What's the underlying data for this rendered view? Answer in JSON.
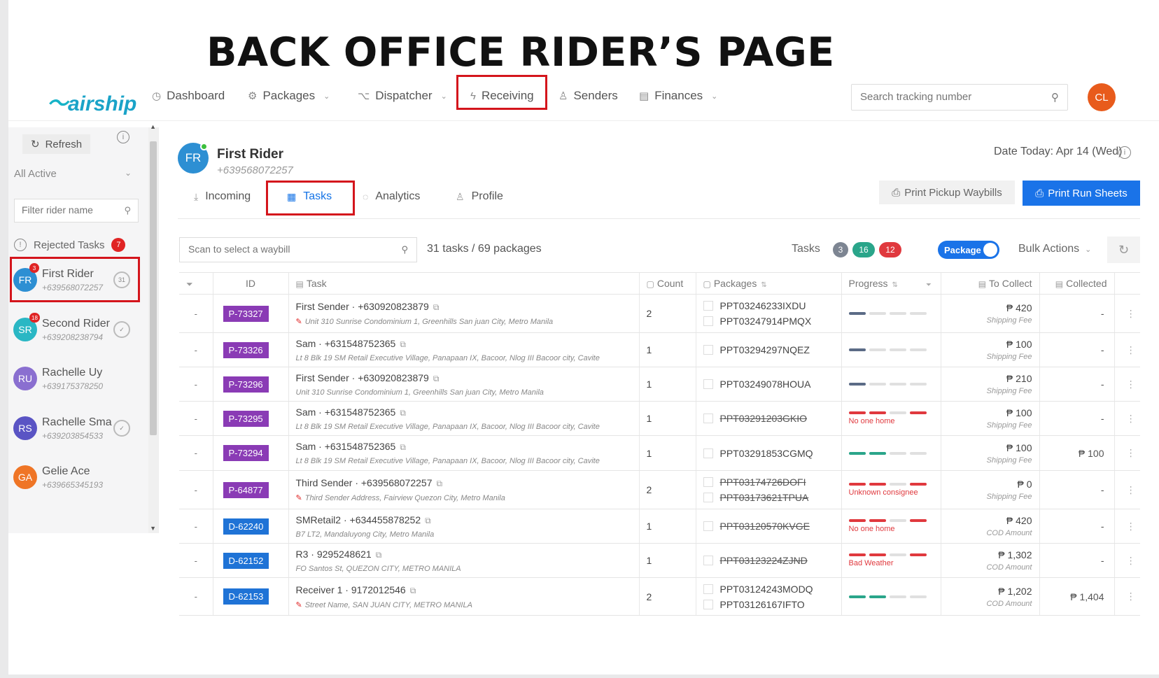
{
  "banner": "BACK OFFICE RIDER’S PAGE",
  "nav": {
    "logo": "airship",
    "items": [
      {
        "label": "Dashboard",
        "icon": "dashboard-icon"
      },
      {
        "label": "Packages",
        "icon": "box-icon"
      },
      {
        "label": "Dispatcher",
        "icon": "route-icon"
      },
      {
        "label": "Receiving",
        "icon": "bolt-icon"
      },
      {
        "label": "Senders",
        "icon": "user-icon"
      },
      {
        "label": "Finances",
        "icon": "ledger-icon"
      }
    ],
    "search_placeholder": "Search tracking number",
    "user_initials": "CL"
  },
  "sidebar": {
    "refresh": "Refresh",
    "filter_select": "All Active",
    "filter_placeholder": "Filter rider name",
    "rejected_label": "Rejected Tasks",
    "rejected_count": "7",
    "riders": [
      {
        "initials": "FR",
        "name": "First Rider",
        "phone": "+639568072257",
        "badge": "3",
        "count": "31",
        "color": "#2d8fd3"
      },
      {
        "initials": "SR",
        "name": "Second Rider",
        "phone": "+639208238794",
        "badge": "18",
        "count": "✓",
        "color": "#2ab7c4"
      },
      {
        "initials": "RU",
        "name": "Rachelle Uy",
        "phone": "+639175378250",
        "badge": "",
        "count": "",
        "color": "#8a6fd0"
      },
      {
        "initials": "RS",
        "name": "Rachelle Smal",
        "phone": "+639203854533",
        "badge": "",
        "count": "✓",
        "color": "#5a54c4"
      },
      {
        "initials": "GA",
        "name": "Gelie Ace",
        "phone": "+639665345193",
        "badge": "",
        "count": "",
        "color": "#ef7526"
      }
    ]
  },
  "rider": {
    "initials": "FR",
    "name": "First Rider",
    "phone": "+639568072257",
    "date_today": "Date Today: Apr 14 (Wed)",
    "tabs": [
      "Incoming",
      "Tasks",
      "Analytics",
      "Profile"
    ],
    "print_pickup": "Print Pickup Waybills",
    "print_run": "Print Run Sheets"
  },
  "toolbar": {
    "scan_placeholder": "Scan to select a waybill",
    "counts": "31 tasks / 69 packages",
    "tasks_label": "Tasks",
    "pill_grey": "3",
    "pill_green": "16",
    "pill_red": "12",
    "toggle_label": "Package",
    "bulk_actions": "Bulk Actions"
  },
  "table": {
    "headers": [
      "ID",
      "Task",
      "Count",
      "Packages",
      "Progress",
      "To Collect",
      "Collected"
    ],
    "rows": [
      {
        "dash": "-",
        "id": "P-73327",
        "kind": "p",
        "sender": "First Sender · +630920823879",
        "addr": "Unit 310 Sunrise Condominium 1, Greenhills San juan City, Metro Manila",
        "edit": true,
        "count": "2",
        "pkgs": [
          {
            "id": "PPT03246233IXDU",
            "strike": false
          },
          {
            "id": "PPT03247914PMQX",
            "strike": false
          }
        ],
        "prog": [
          "g",
          "l",
          "l",
          "l"
        ],
        "note": "",
        "amount": "₱ 420",
        "fee": "Shipping Fee",
        "collected": "-"
      },
      {
        "dash": "-",
        "id": "P-73326",
        "kind": "p",
        "sender": "Sam · +631548752365",
        "addr": "Lt 8 Blk 19 SM Retail Executive Village, Panapaan IX, Bacoor, Nlog III Bacoor city, Cavite",
        "edit": false,
        "count": "1",
        "pkgs": [
          {
            "id": "PPT03294297NQEZ",
            "strike": false
          }
        ],
        "prog": [
          "g",
          "l",
          "l",
          "l"
        ],
        "note": "",
        "amount": "₱ 100",
        "fee": "Shipping Fee",
        "collected": "-"
      },
      {
        "dash": "-",
        "id": "P-73296",
        "kind": "p",
        "sender": "First Sender · +630920823879",
        "addr": "Unit 310 Sunrise Condominium 1, Greenhills San juan City, Metro Manila",
        "edit": false,
        "count": "1",
        "pkgs": [
          {
            "id": "PPT03249078HOUA",
            "strike": false
          }
        ],
        "prog": [
          "g",
          "l",
          "l",
          "l"
        ],
        "note": "",
        "amount": "₱ 210",
        "fee": "Shipping Fee",
        "collected": "-"
      },
      {
        "dash": "-",
        "id": "P-73295",
        "kind": "p",
        "sender": "Sam · +631548752365",
        "addr": "Lt 8 Blk 19 SM Retail Executive Village, Panapaan IX, Bacoor, Nlog III Bacoor city, Cavite",
        "edit": false,
        "count": "1",
        "pkgs": [
          {
            "id": "PPT03291203GKIO",
            "strike": true
          }
        ],
        "prog": [
          "r",
          "r",
          "l",
          "r"
        ],
        "note": "No one home",
        "amount": "₱ 100",
        "fee": "Shipping Fee",
        "collected": "-"
      },
      {
        "dash": "-",
        "id": "P-73294",
        "kind": "p",
        "sender": "Sam · +631548752365",
        "addr": "Lt 8 Blk 19 SM Retail Executive Village, Panapaan IX, Bacoor, Nlog III Bacoor city, Cavite",
        "edit": false,
        "count": "1",
        "pkgs": [
          {
            "id": "PPT03291853CGMQ",
            "strike": false
          }
        ],
        "prog": [
          "t",
          "t",
          "l",
          "l"
        ],
        "note": "",
        "amount": "₱ 100",
        "fee": "Shipping Fee",
        "collected": "₱ 100"
      },
      {
        "dash": "-",
        "id": "P-64877",
        "kind": "p",
        "sender": "Third Sender · +639568072257",
        "addr": "Third Sender Address, Fairview Quezon City, Metro Manila",
        "edit": true,
        "count": "2",
        "pkgs": [
          {
            "id": "PPT03174726DOFI",
            "strike": true
          },
          {
            "id": "PPT03173621TPUA",
            "strike": true
          }
        ],
        "prog": [
          "r",
          "r",
          "l",
          "r"
        ],
        "note": "Unknown consignee",
        "amount": "₱ 0",
        "fee": "Shipping Fee",
        "collected": "-"
      },
      {
        "dash": "-",
        "id": "D-62240",
        "kind": "d",
        "sender": "SMRetail2 · +634455878252",
        "addr": "B7 LT2, Mandaluyong City, Metro Manila",
        "edit": false,
        "count": "1",
        "pkgs": [
          {
            "id": "PPT03120570KVGE",
            "strike": true
          }
        ],
        "prog": [
          "r",
          "r",
          "l",
          "r"
        ],
        "note": "No one home",
        "amount": "₱ 420",
        "fee": "COD Amount",
        "collected": "-"
      },
      {
        "dash": "-",
        "id": "D-62152",
        "kind": "d",
        "sender": "R3 · 9295248621",
        "addr": "FO Santos St, QUEZON CITY, METRO MANILA",
        "edit": false,
        "count": "1",
        "pkgs": [
          {
            "id": "PPT03123224ZJND",
            "strike": true
          }
        ],
        "prog": [
          "r",
          "r",
          "l",
          "r"
        ],
        "note": "Bad Weather",
        "amount": "₱ 1,302",
        "fee": "COD Amount",
        "collected": "-"
      },
      {
        "dash": "-",
        "id": "D-62153",
        "kind": "d",
        "sender": "Receiver 1 · 9172012546",
        "addr": "Street Name, SAN JUAN CITY, METRO MANILA",
        "edit": true,
        "count": "2",
        "pkgs": [
          {
            "id": "PPT03124243MODQ",
            "strike": false
          },
          {
            "id": "PPT03126167IFTO",
            "strike": false
          }
        ],
        "prog": [
          "t",
          "t",
          "l",
          "l"
        ],
        "note": "",
        "amount": "₱ 1,202",
        "fee": "COD Amount",
        "collected": "₱ 1,404"
      }
    ]
  }
}
